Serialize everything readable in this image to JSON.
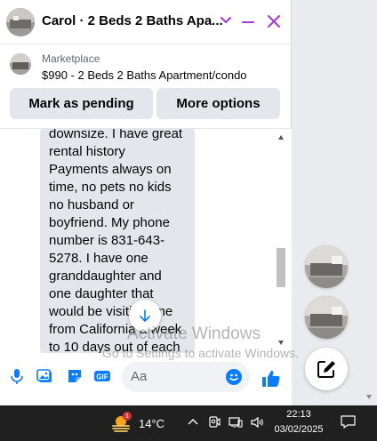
{
  "chat": {
    "title": "Carol · 2 Beds 2 Baths Apa...",
    "listing": {
      "source": "Marketplace",
      "title": "$990 - 2 Beds 2 Baths Apartment/condo"
    },
    "buttons": {
      "mark_pending": "Mark as pending",
      "more_options": "More options"
    },
    "message": "downsize. I have great\nrental history\nPayments always on\ntime, no pets no kids\nno husband or\nboyfriend. My phone\nnumber is 831-643-\n5278. I have one\ngranddaughter and\none daughter that\nwould be visiting one\nfrom California a week\nto 10 days out of each",
    "composer": {
      "placeholder": "Aa"
    }
  },
  "watermark": {
    "line1": "Activate Windows",
    "line2": "Go to Settings to activate Windows."
  },
  "taskbar": {
    "temperature": "14°C",
    "badge": "1",
    "time": "22:13",
    "date": "03/02/2025"
  },
  "colors": {
    "accent": "#a737d7",
    "messenger_blue": "#0a7cff",
    "bubble": "#e4e6eb",
    "taskbar": "#202020"
  },
  "icons": [
    "chevron-down-icon",
    "minimize-icon",
    "close-icon",
    "arrow-down-icon",
    "microphone-icon",
    "photo-icon",
    "sticker-icon",
    "gif-icon",
    "emoji-icon",
    "like-thumb-icon",
    "compose-icon",
    "weather-icon",
    "chevron-up-icon",
    "meet-icon",
    "network-icon",
    "volume-icon",
    "notification-icon"
  ]
}
